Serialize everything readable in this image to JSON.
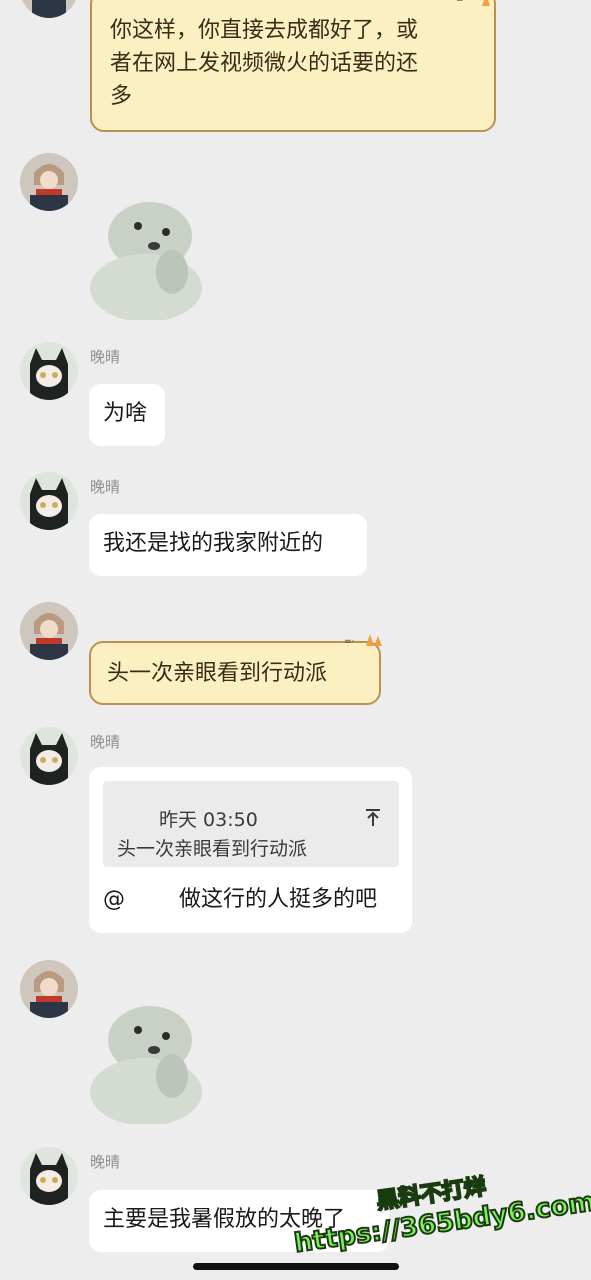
{
  "contacts": {
    "other_name": "晚晴"
  },
  "messages": {
    "m1_lines": [
      "你这样，你直接去成都好了，或",
      "者在网上发视频微火的话要的还",
      "多"
    ],
    "m4": "为啥",
    "m5": "我还是找的我家附近的",
    "m6": "头一次亲眼看到行动派",
    "m7": {
      "quote_time": "昨天 03:50",
      "quote_text": "头一次亲眼看到行动派",
      "at_symbol": "@",
      "text": "做这行的人挺多的吧"
    },
    "m9": "主要是我暑假放的太晚了"
  },
  "watermark": {
    "line1": "黑料不打烊",
    "line2": "https://365bdy6.com"
  },
  "colors": {
    "background": "#ededed",
    "bubble": "#ffffff",
    "yellow_bubble": "#fcf0c2",
    "yellow_border": "#b8934f",
    "watermark_fill": "#7cf05a"
  }
}
